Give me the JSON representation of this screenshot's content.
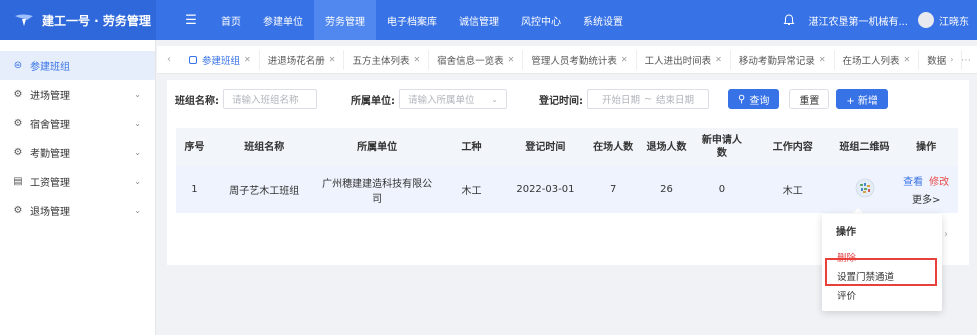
{
  "app": {
    "title": "建工一号 · 劳务管理"
  },
  "topnav": {
    "items": [
      "首页",
      "参建单位",
      "劳务管理",
      "电子档案库",
      "诚信管理",
      "风控中心",
      "系统设置"
    ],
    "active_index": 2
  },
  "user": {
    "company": "湛江农垦第一机械有...",
    "name": "江晓东"
  },
  "sidebar": {
    "items": [
      {
        "label": "参建班组",
        "icon": "team-icon",
        "active": true
      },
      {
        "label": "进场管理",
        "icon": "gear-icon"
      },
      {
        "label": "宿舍管理",
        "icon": "gear-icon"
      },
      {
        "label": "考勤管理",
        "icon": "gear-icon"
      },
      {
        "label": "工资管理",
        "icon": "wallet-icon"
      },
      {
        "label": "退场管理",
        "icon": "gear-icon"
      }
    ]
  },
  "tabs": [
    {
      "label": "参建班组",
      "active": true
    },
    {
      "label": "进退场花名册"
    },
    {
      "label": "五方主体列表"
    },
    {
      "label": "宿舍信息一览表"
    },
    {
      "label": "管理人员考勤统计表"
    },
    {
      "label": "工人进出时间表"
    },
    {
      "label": "移动考勤异常记录"
    },
    {
      "label": "在场工人列表"
    },
    {
      "label": "数据"
    }
  ],
  "filters": {
    "team_label": "班组名称:",
    "team_placeholder": "请输入班组名称",
    "unit_label": "所属单位:",
    "unit_placeholder": "请输入所属单位",
    "date_label": "登记时间:",
    "date_start": "开始日期",
    "date_sep": "~",
    "date_end": "结束日期",
    "search_label": "查询",
    "reset_label": "重置",
    "add_label": "+ 新增"
  },
  "table": {
    "headers": [
      "序号",
      "班组名称",
      "所属单位",
      "工种",
      "登记时间",
      "在场人数",
      "退场人数",
      "新申请人数",
      "工作内容",
      "班组二维码",
      "操作"
    ],
    "rows": [
      {
        "index": "1",
        "team": "周子艺木工班组",
        "unit": "广州穗建建造科技有限公司",
        "trade": "木工",
        "date": "2022-03-01",
        "onsite": "7",
        "exited": "26",
        "new_apply": "0",
        "work": "木工",
        "view": "查看",
        "edit": "修改",
        "more": "更多>"
      }
    ]
  },
  "dropdown": {
    "title": "操作",
    "items": [
      "删除",
      "设置门禁通道",
      "评价"
    ]
  },
  "colors": {
    "primary": "#3772e6",
    "danger": "#e84a4a",
    "highlight": "#e8403b"
  }
}
